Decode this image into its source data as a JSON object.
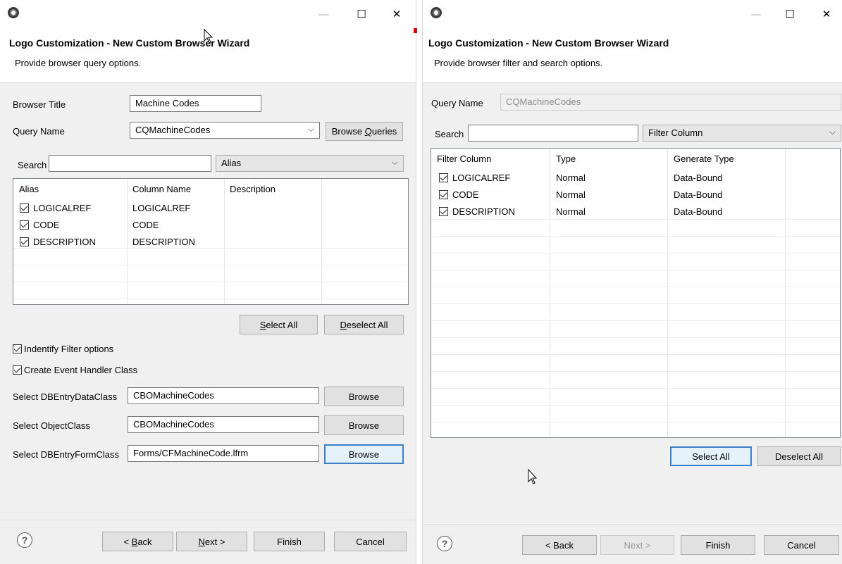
{
  "left": {
    "title": "Logo Customization - New Custom Browser Wizard",
    "description": "Provide browser query options.",
    "browser_title_label": "Browser Title",
    "browser_title_value": "Machine Codes",
    "query_name_label": "Query Name",
    "query_name_value": "CQMachineCodes",
    "browse_queries_label_pre": "Browse ",
    "browse_queries_label_ul": "Q",
    "browse_queries_label_post": "ueries",
    "search_label": "Search",
    "search_value": "",
    "search_column": "Alias",
    "columns": [
      "Alias",
      "Column Name",
      "Description"
    ],
    "rows": [
      {
        "alias": "LOGICALREF",
        "column": "LOGICALREF",
        "description": ""
      },
      {
        "alias": "CODE",
        "column": "CODE",
        "description": ""
      },
      {
        "alias": "DESCRIPTION",
        "column": "DESCRIPTION",
        "description": ""
      }
    ],
    "select_all_ul": "S",
    "select_all_rest": "elect All",
    "deselect_all_ul": "D",
    "deselect_all_rest": "eselect All",
    "identify_filter_label": "Indentify Filter options",
    "create_event_label": "Create Event Handler Class",
    "dbentry_data_label": "Select DBEntryDataClass",
    "dbentry_data_value": "CBOMachineCodes",
    "object_class_label": "Select ObjectClass",
    "object_class_value": "CBOMachineCodes",
    "dbentry_form_label": "Select DBEntryFormClass",
    "dbentry_form_value": "Forms/CFMachineCode.lfrm",
    "browse_label": "Browse",
    "back_pre": "< ",
    "back_ul": "B",
    "back_post": "ack",
    "next_ul": "N",
    "next_post": "ext >",
    "finish_label": "Finish",
    "cancel_label": "Cancel"
  },
  "right": {
    "title": "Logo Customization - New Custom Browser Wizard",
    "description": "Provide browser filter and search options.",
    "query_name_label": "Query Name",
    "query_name_value": "CQMachineCodes",
    "search_label": "Search",
    "search_value": "",
    "search_column": "Filter Column",
    "columns": [
      "Filter Column",
      "Type",
      "Generate Type"
    ],
    "rows": [
      {
        "filter": "LOGICALREF",
        "type": "Normal",
        "generate": "Data-Bound"
      },
      {
        "filter": "CODE",
        "type": "Normal",
        "generate": "Data-Bound"
      },
      {
        "filter": "DESCRIPTION",
        "type": "Normal",
        "generate": "Data-Bound"
      }
    ],
    "select_all_label": "Select All",
    "deselect_all_label": "Deselect All",
    "back_label": "< Back",
    "next_label": "Next >",
    "finish_label": "Finish",
    "cancel_label": "Cancel"
  },
  "window_controls": {
    "minimize": "—",
    "maximize": "☐",
    "close": "✕"
  },
  "help_glyph": "?",
  "chevron": "⌵"
}
